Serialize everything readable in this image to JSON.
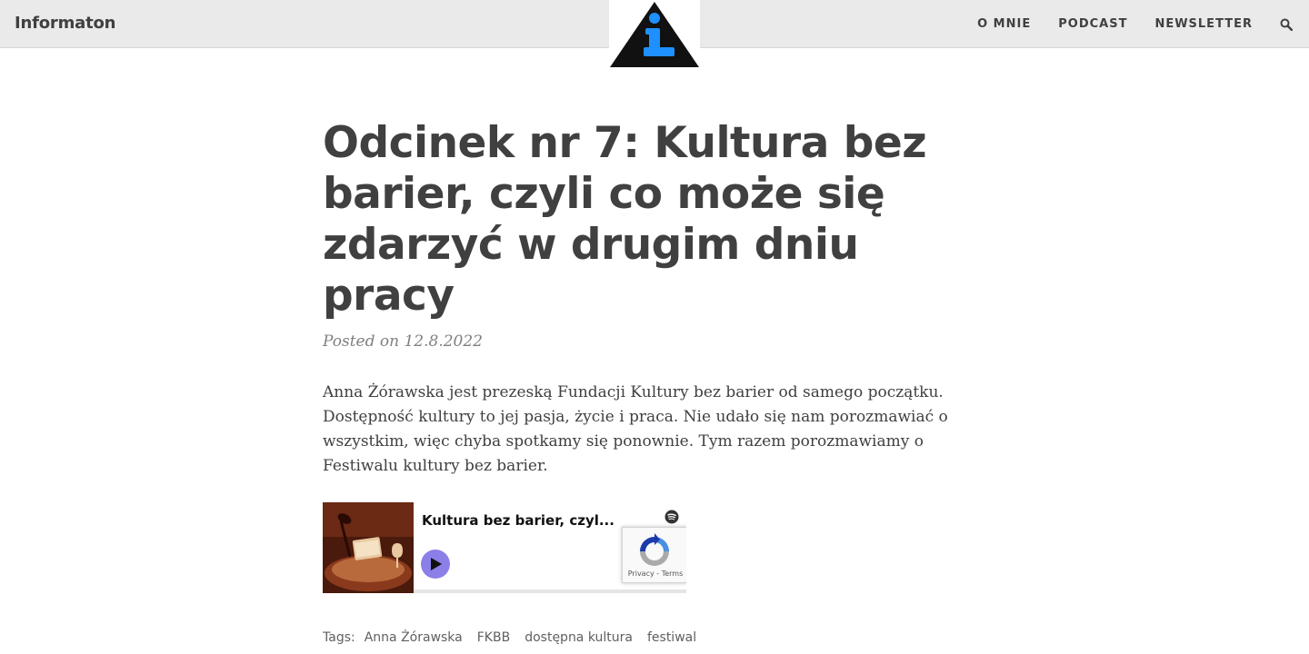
{
  "nav": {
    "brand": "Informaton",
    "links": [
      "O MNIE",
      "PODCAST",
      "NEWSLETTER"
    ],
    "logo_letter": "i",
    "logo_colors": {
      "triangle": "#111111",
      "letter": "#1e90ff"
    }
  },
  "post": {
    "title": "Odcinek nr 7: Kultura bez barier, czyli co może się zdarzyć w drugim dniu pracy",
    "meta": "Posted on 12.8.2022",
    "body": "Anna Żórawska jest prezeską Fundacji Kultury bez barier od samego początku. Dostępność kultury to jej pasja, życie i praca. Nie udało się nam porozmawiać o wszystkim, więc chyba spotkamy się ponownie. Tym razem porozmawiamy o Festiwalu kultury bez barier."
  },
  "embed": {
    "title": "Kultura bez barier, czyl...",
    "play_color": "#8b7fe8",
    "recaptcha_text": "Privacy - Terms"
  },
  "tags": {
    "label": "Tags:",
    "items": [
      "Anna Żórawska",
      "FKBB",
      "dostępna kultura",
      "festiwal"
    ]
  }
}
